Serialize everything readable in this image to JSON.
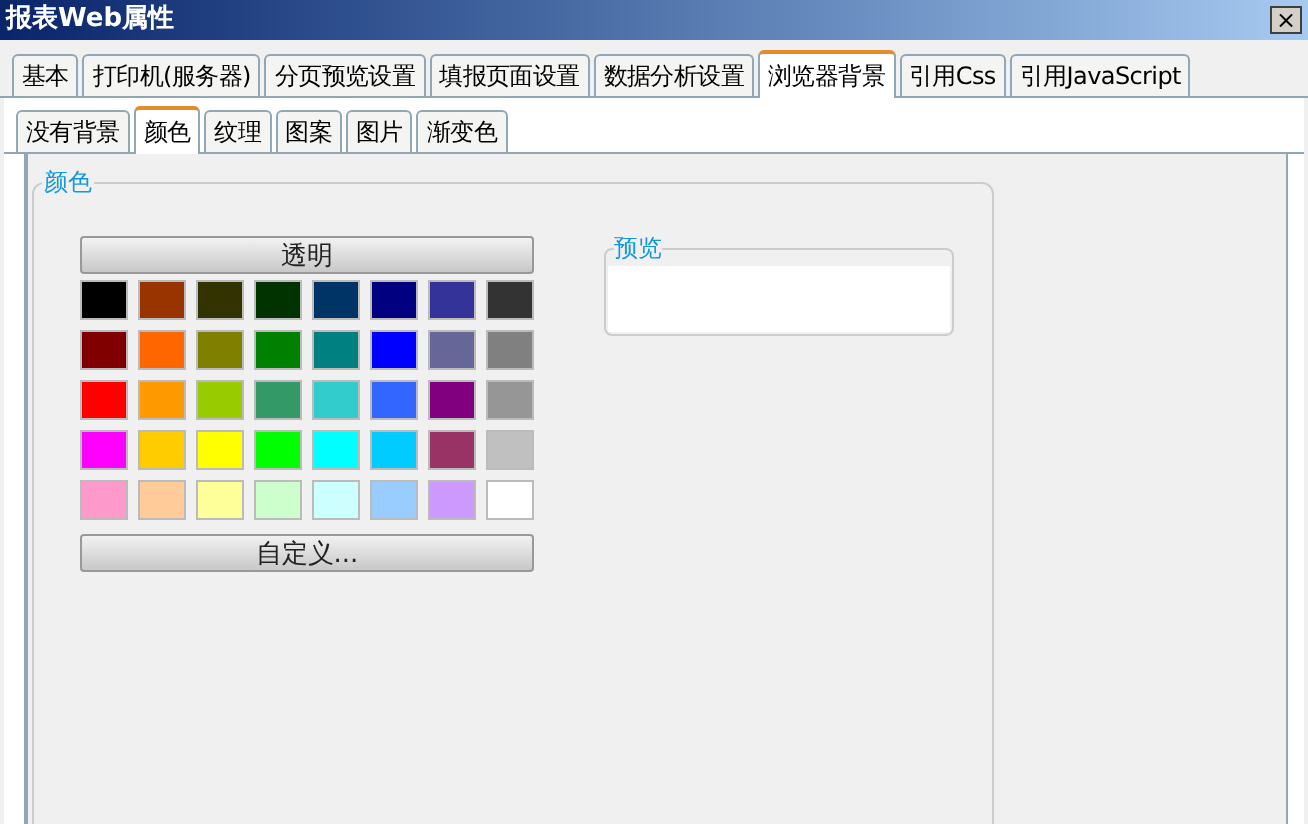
{
  "window": {
    "title": "报表Web属性",
    "close": "×"
  },
  "tabs": [
    {
      "label": "基本",
      "selected": false
    },
    {
      "label": "打印机(服务器)",
      "selected": false
    },
    {
      "label": "分页预览设置",
      "selected": false
    },
    {
      "label": "填报页面设置",
      "selected": false
    },
    {
      "label": "数据分析设置",
      "selected": false
    },
    {
      "label": "浏览器背景",
      "selected": true
    },
    {
      "label": "引用Css",
      "selected": false
    },
    {
      "label": "引用JavaScript",
      "selected": false
    }
  ],
  "subtabs": [
    {
      "label": "没有背景",
      "selected": false
    },
    {
      "label": "颜色",
      "selected": true
    },
    {
      "label": "纹理",
      "selected": false
    },
    {
      "label": "图案",
      "selected": false
    },
    {
      "label": "图片",
      "selected": false
    },
    {
      "label": "渐变色",
      "selected": false
    }
  ],
  "color_group": {
    "title": "颜色",
    "transparent_button": "透明",
    "custom_button": "自定义...",
    "swatches": [
      {
        "color": "#000000"
      },
      {
        "color": "#993300"
      },
      {
        "color": "#333300"
      },
      {
        "color": "#003300"
      },
      {
        "color": "#003366"
      },
      {
        "color": "#000080"
      },
      {
        "color": "#333399"
      },
      {
        "color": "#333333"
      },
      {
        "color": "#800000"
      },
      {
        "color": "#ff6600"
      },
      {
        "color": "#808000"
      },
      {
        "color": "#008000"
      },
      {
        "color": "#008080"
      },
      {
        "color": "#0000ff"
      },
      {
        "color": "#666699"
      },
      {
        "color": "#808080"
      },
      {
        "color": "#ff0000"
      },
      {
        "color": "#ff9900"
      },
      {
        "color": "#99cc00"
      },
      {
        "color": "#339966"
      },
      {
        "color": "#33cccc"
      },
      {
        "color": "#3366ff"
      },
      {
        "color": "#800080"
      },
      {
        "color": "#969696"
      },
      {
        "color": "#ff00ff"
      },
      {
        "color": "#ffcc00"
      },
      {
        "color": "#ffff00"
      },
      {
        "color": "#00ff00"
      },
      {
        "color": "#00ffff"
      },
      {
        "color": "#00ccff"
      },
      {
        "color": "#993366"
      },
      {
        "color": "#c0c0c0"
      },
      {
        "color": "#ff99cc"
      },
      {
        "color": "#ffcc99"
      },
      {
        "color": "#ffff99"
      },
      {
        "color": "#ccffcc"
      },
      {
        "color": "#ccffff"
      },
      {
        "color": "#99ccff"
      },
      {
        "color": "#cc99ff"
      },
      {
        "color": "#ffffff"
      }
    ]
  },
  "preview": {
    "title": "预览"
  }
}
